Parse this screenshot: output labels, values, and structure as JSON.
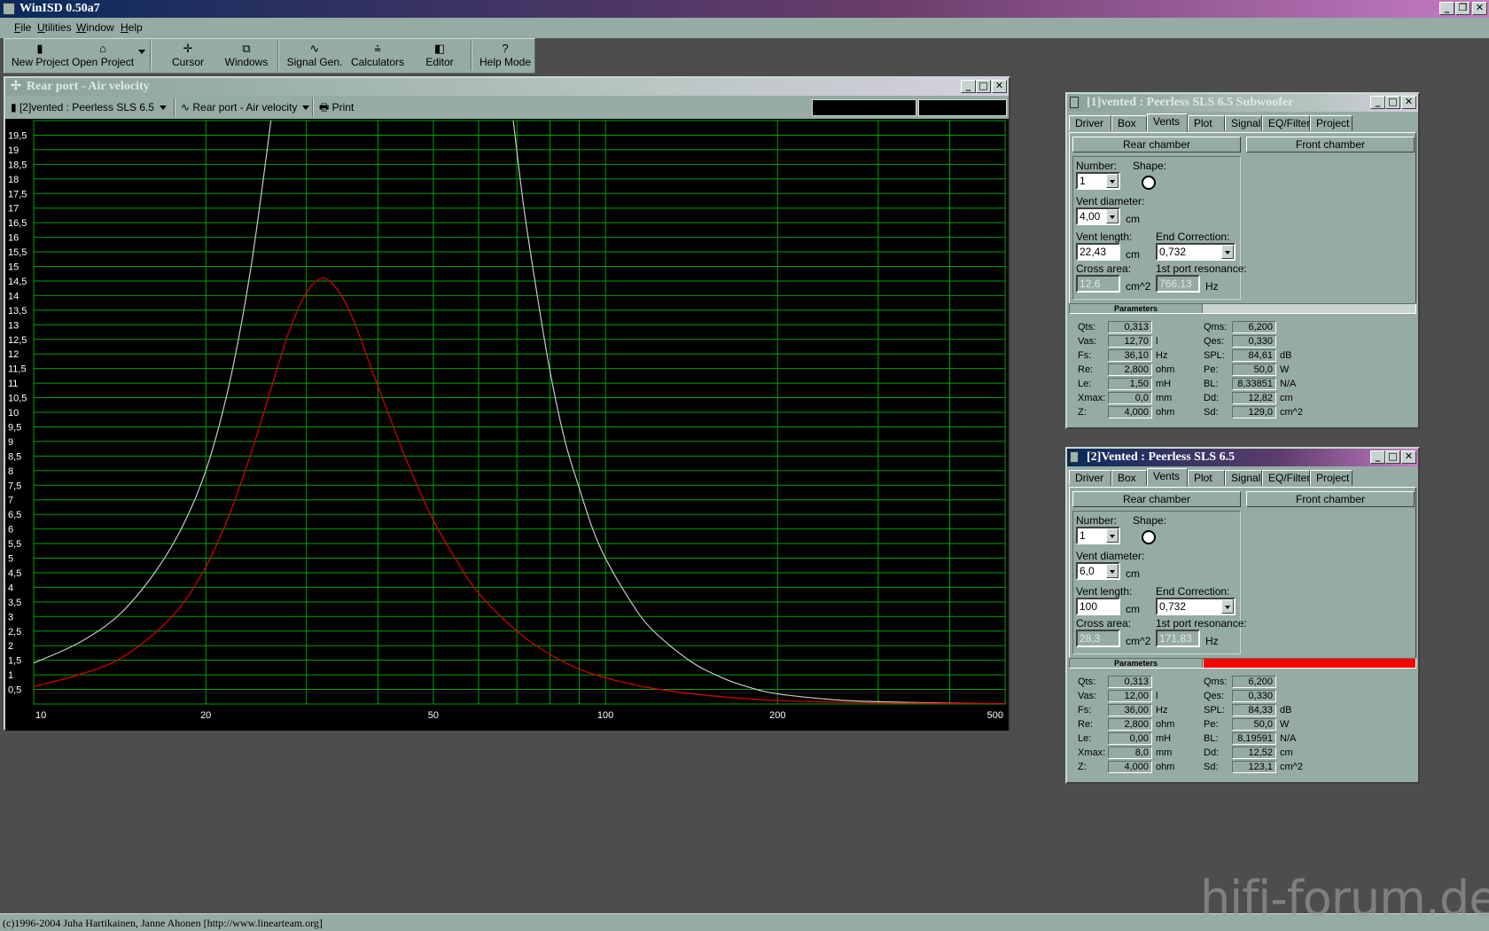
{
  "app": {
    "title": "WinISD 0.50a7",
    "menu": [
      "File",
      "Utilities",
      "Window",
      "Help"
    ],
    "toolbar": {
      "new_project": "New Project",
      "open_project": "Open Project",
      "cursor": "Cursor",
      "windows": "Windows",
      "signal_gen": "Signal Gen.",
      "calculators": "Calculators",
      "editor": "Editor",
      "help_mode": "Help Mode"
    },
    "status": "(c)1996-2004 Juha Hartikainen, Janne Ahonen [http://www.linearteam.org]",
    "watermark": "hifi-forum.de"
  },
  "graph_window": {
    "title": "Rear port - Air velocity",
    "project_select": "[2]vented : Peerless SLS 6.5",
    "graph_select": "Rear port - Air velocity",
    "print": "Print"
  },
  "chart_data": {
    "type": "line",
    "title": "Rear port - Air velocity",
    "xlabel": "",
    "ylabel": "",
    "x_scale": "log",
    "xlim": [
      10,
      500
    ],
    "ylim": [
      0,
      20
    ],
    "x_ticks": [
      "10",
      "20",
      "50",
      "100",
      "200",
      "500"
    ],
    "y_ticks": [
      "0,5",
      "1",
      "1,5",
      "2",
      "2,5",
      "3",
      "3,5",
      "4",
      "4,5",
      "5",
      "5,5",
      "6",
      "6,5",
      "7",
      "7,5",
      "8",
      "8,5",
      "9",
      "9,5",
      "10",
      "10,5",
      "11",
      "11,5",
      "12",
      "12,5",
      "13",
      "13,5",
      "14",
      "14,5",
      "15",
      "15,5",
      "16",
      "16,5",
      "17",
      "17,5",
      "18",
      "18,5",
      "19",
      "19,5"
    ],
    "grid": true,
    "background": "#000000",
    "grid_color": "#00a000",
    "series": [
      {
        "color": "#c8c8c8",
        "x": [
          10,
          12,
          14,
          16,
          18,
          20,
          22,
          24,
          26,
          69,
          72,
          76,
          80,
          85,
          90,
          95,
          100,
          110,
          120,
          140,
          160,
          180,
          200,
          250,
          300,
          400,
          500
        ],
        "y": [
          1.4,
          2.1,
          3.0,
          4.3,
          5.9,
          8.0,
          11.0,
          15.0,
          20.0,
          20.0,
          17.0,
          14.0,
          11.4,
          9.0,
          7.4,
          6.0,
          5.0,
          3.6,
          2.6,
          1.5,
          0.9,
          0.55,
          0.35,
          0.15,
          0.08,
          0.03,
          0.01
        ]
      },
      {
        "color": "#e00000",
        "x": [
          10,
          12,
          14,
          16,
          18,
          20,
          22,
          24,
          26,
          28,
          30,
          32,
          34,
          36,
          38,
          40,
          45,
          50,
          55,
          60,
          70,
          80,
          90,
          100,
          120,
          150,
          200,
          300,
          500
        ],
        "y": [
          0.6,
          1.0,
          1.5,
          2.3,
          3.3,
          4.7,
          6.5,
          8.6,
          10.8,
          12.8,
          14.1,
          14.6,
          14.2,
          13.3,
          12.1,
          10.9,
          8.3,
          6.3,
          4.9,
          3.8,
          2.5,
          1.7,
          1.2,
          0.9,
          0.55,
          0.3,
          0.12,
          0.04,
          0.01
        ]
      }
    ]
  },
  "dialogs": [
    {
      "title": "[1]vented : Peerless SLS 6.5 Subwoofer",
      "active": false,
      "tabs": [
        "Driver",
        "Box",
        "Vents",
        "Plot",
        "Signal",
        "EQ/Filter",
        "Project"
      ],
      "selected_tab": "Vents",
      "rear_chamber": "Rear chamber",
      "front_chamber": "Front chamber",
      "number_label": "Number:",
      "number": "1",
      "shape_label": "Shape:",
      "vent_diameter_label": "Vent diameter:",
      "vent_diameter": "4,00",
      "vent_diameter_unit": "cm",
      "vent_length_label": "Vent length:",
      "vent_length": "22,43",
      "vent_length_unit": "cm",
      "end_correction_label": "End Correction:",
      "end_correction": "0,732",
      "cross_area_label": "Cross area:",
      "cross_area": "12,6",
      "cross_area_unit": "cm^2",
      "port_res_label": "1st port resonance:",
      "port_res": "766,13",
      "port_res_unit": "Hz",
      "params_label": "Parameters",
      "params_fill": "#c8d4cf",
      "params_left": [
        {
          "label": "Qts:",
          "value": "0,313",
          "unit": ""
        },
        {
          "label": "Vas:",
          "value": "12,70",
          "unit": "l"
        },
        {
          "label": "Fs:",
          "value": "36,10",
          "unit": "Hz"
        },
        {
          "label": "Re:",
          "value": "2,800",
          "unit": "ohm"
        },
        {
          "label": "Le:",
          "value": "1,50",
          "unit": "mH"
        },
        {
          "label": "Xmax:",
          "value": "0,0",
          "unit": "mm"
        },
        {
          "label": "Z:",
          "value": "4,000",
          "unit": "ohm"
        }
      ],
      "params_right": [
        {
          "label": "Qms:",
          "value": "6,200",
          "unit": ""
        },
        {
          "label": "Qes:",
          "value": "0,330",
          "unit": ""
        },
        {
          "label": "SPL:",
          "value": "84,61",
          "unit": "dB"
        },
        {
          "label": "Pe:",
          "value": "50,0",
          "unit": "W"
        },
        {
          "label": "BL:",
          "value": "8,33851",
          "unit": "N/A"
        },
        {
          "label": "Dd:",
          "value": "12,82",
          "unit": "cm"
        },
        {
          "label": "Sd:",
          "value": "129,0",
          "unit": "cm^2"
        }
      ]
    },
    {
      "title": "[2]Vented : Peerless SLS 6.5",
      "active": true,
      "tabs": [
        "Driver",
        "Box",
        "Vents",
        "Plot",
        "Signal",
        "EQ/Filter",
        "Project"
      ],
      "selected_tab": "Vents",
      "rear_chamber": "Rear chamber",
      "front_chamber": "Front chamber",
      "number_label": "Number:",
      "number": "1",
      "shape_label": "Shape:",
      "vent_diameter_label": "Vent diameter:",
      "vent_diameter": "6,0",
      "vent_diameter_unit": "cm",
      "vent_length_label": "Vent length:",
      "vent_length": "100",
      "vent_length_unit": "cm",
      "end_correction_label": "End Correction:",
      "end_correction": "0,732",
      "cross_area_label": "Cross area:",
      "cross_area": "28,3",
      "cross_area_unit": "cm^2",
      "port_res_label": "1st port resonance:",
      "port_res": "171,83",
      "port_res_unit": "Hz",
      "params_label": "Parameters",
      "params_fill": "#ff0000",
      "params_left": [
        {
          "label": "Qts:",
          "value": "0,313",
          "unit": ""
        },
        {
          "label": "Vas:",
          "value": "12,00",
          "unit": "l"
        },
        {
          "label": "Fs:",
          "value": "36,00",
          "unit": "Hz"
        },
        {
          "label": "Re:",
          "value": "2,800",
          "unit": "ohm"
        },
        {
          "label": "Le:",
          "value": "0,00",
          "unit": "mH"
        },
        {
          "label": "Xmax:",
          "value": "8,0",
          "unit": "mm"
        },
        {
          "label": "Z:",
          "value": "4,000",
          "unit": "ohm"
        }
      ],
      "params_right": [
        {
          "label": "Qms:",
          "value": "6,200",
          "unit": ""
        },
        {
          "label": "Qes:",
          "value": "0,330",
          "unit": ""
        },
        {
          "label": "SPL:",
          "value": "84,33",
          "unit": "dB"
        },
        {
          "label": "Pe:",
          "value": "50,0",
          "unit": "W"
        },
        {
          "label": "BL:",
          "value": "8,19591",
          "unit": "N/A"
        },
        {
          "label": "Dd:",
          "value": "12,52",
          "unit": "cm"
        },
        {
          "label": "Sd:",
          "value": "123,1",
          "unit": "cm^2"
        }
      ]
    }
  ]
}
